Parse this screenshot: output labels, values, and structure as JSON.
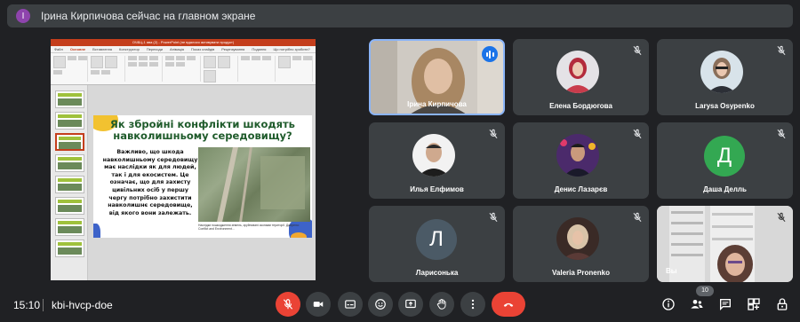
{
  "banner": {
    "avatar_letter": "I",
    "text": "Ірина Кирпичова сейчас на главном экране"
  },
  "presentation": {
    "window_title": "OЧБЦ-1 ява (2) - PowerPoint (не вдалося активувати продукт)",
    "menu": [
      "Файл",
      "Основне",
      "Вставлення",
      "Конструктор",
      "Переходи",
      "Анімація",
      "Показ слайдів",
      "Рецензування",
      "Подання",
      "Що потрібно зробити?"
    ],
    "active_menu": "Основне",
    "slide_title": "Як збройні конфлікти шкодять навколишньому середовищу?",
    "slide_body": "Важливо, що шкода навколишньому середовищу має наслідки як для людей, так і для екосистем. Це означає, що для захисту цивільних осіб у першу чергу потрібно захистити навколишнє середовище, від якого вони залежать.",
    "slide_caption": "Наслідки пошкодження земель, зруйновані окопами території. Джерело: Conflict and Environment...",
    "accent_colors": {
      "title": "#1f5b2b",
      "yellow": "#f2c230",
      "blue": "#3d63c9",
      "ppt_red": "#c43e1c"
    }
  },
  "participants": [
    {
      "name": "Ірина Кирпичова",
      "type": "video",
      "speaking": true
    },
    {
      "name": "Елена Бордюгова",
      "type": "photo",
      "muted": true
    },
    {
      "name": "Larysa Osypenko",
      "type": "photo",
      "muted": true
    },
    {
      "name": "Илья Елфимов",
      "type": "photo",
      "muted": true
    },
    {
      "name": "Денис Лазарєв",
      "type": "photo",
      "muted": true
    },
    {
      "name": "Даша Делль",
      "type": "letter",
      "letter": "Д",
      "color": "#33a852",
      "muted": true
    },
    {
      "name": "Ларисонька",
      "type": "letter",
      "letter": "Л",
      "color": "#4b5a66",
      "muted": true
    },
    {
      "name": "Valeria Pronenko",
      "type": "photo",
      "muted": true
    },
    {
      "name": "Вы",
      "type": "video",
      "muted": true
    }
  ],
  "bottom_bar": {
    "time": "15:10",
    "meeting_code": "kbi-hvcp-doe",
    "participant_count": "10",
    "controls": [
      "mic-off-icon",
      "camera-icon",
      "captions-icon",
      "emoji-icon",
      "present-icon",
      "raise-hand-icon",
      "more-options-icon",
      "hang-up-icon"
    ],
    "right_controls": [
      "info-icon",
      "people-icon",
      "chat-icon",
      "activities-icon",
      "lock-icon"
    ]
  }
}
